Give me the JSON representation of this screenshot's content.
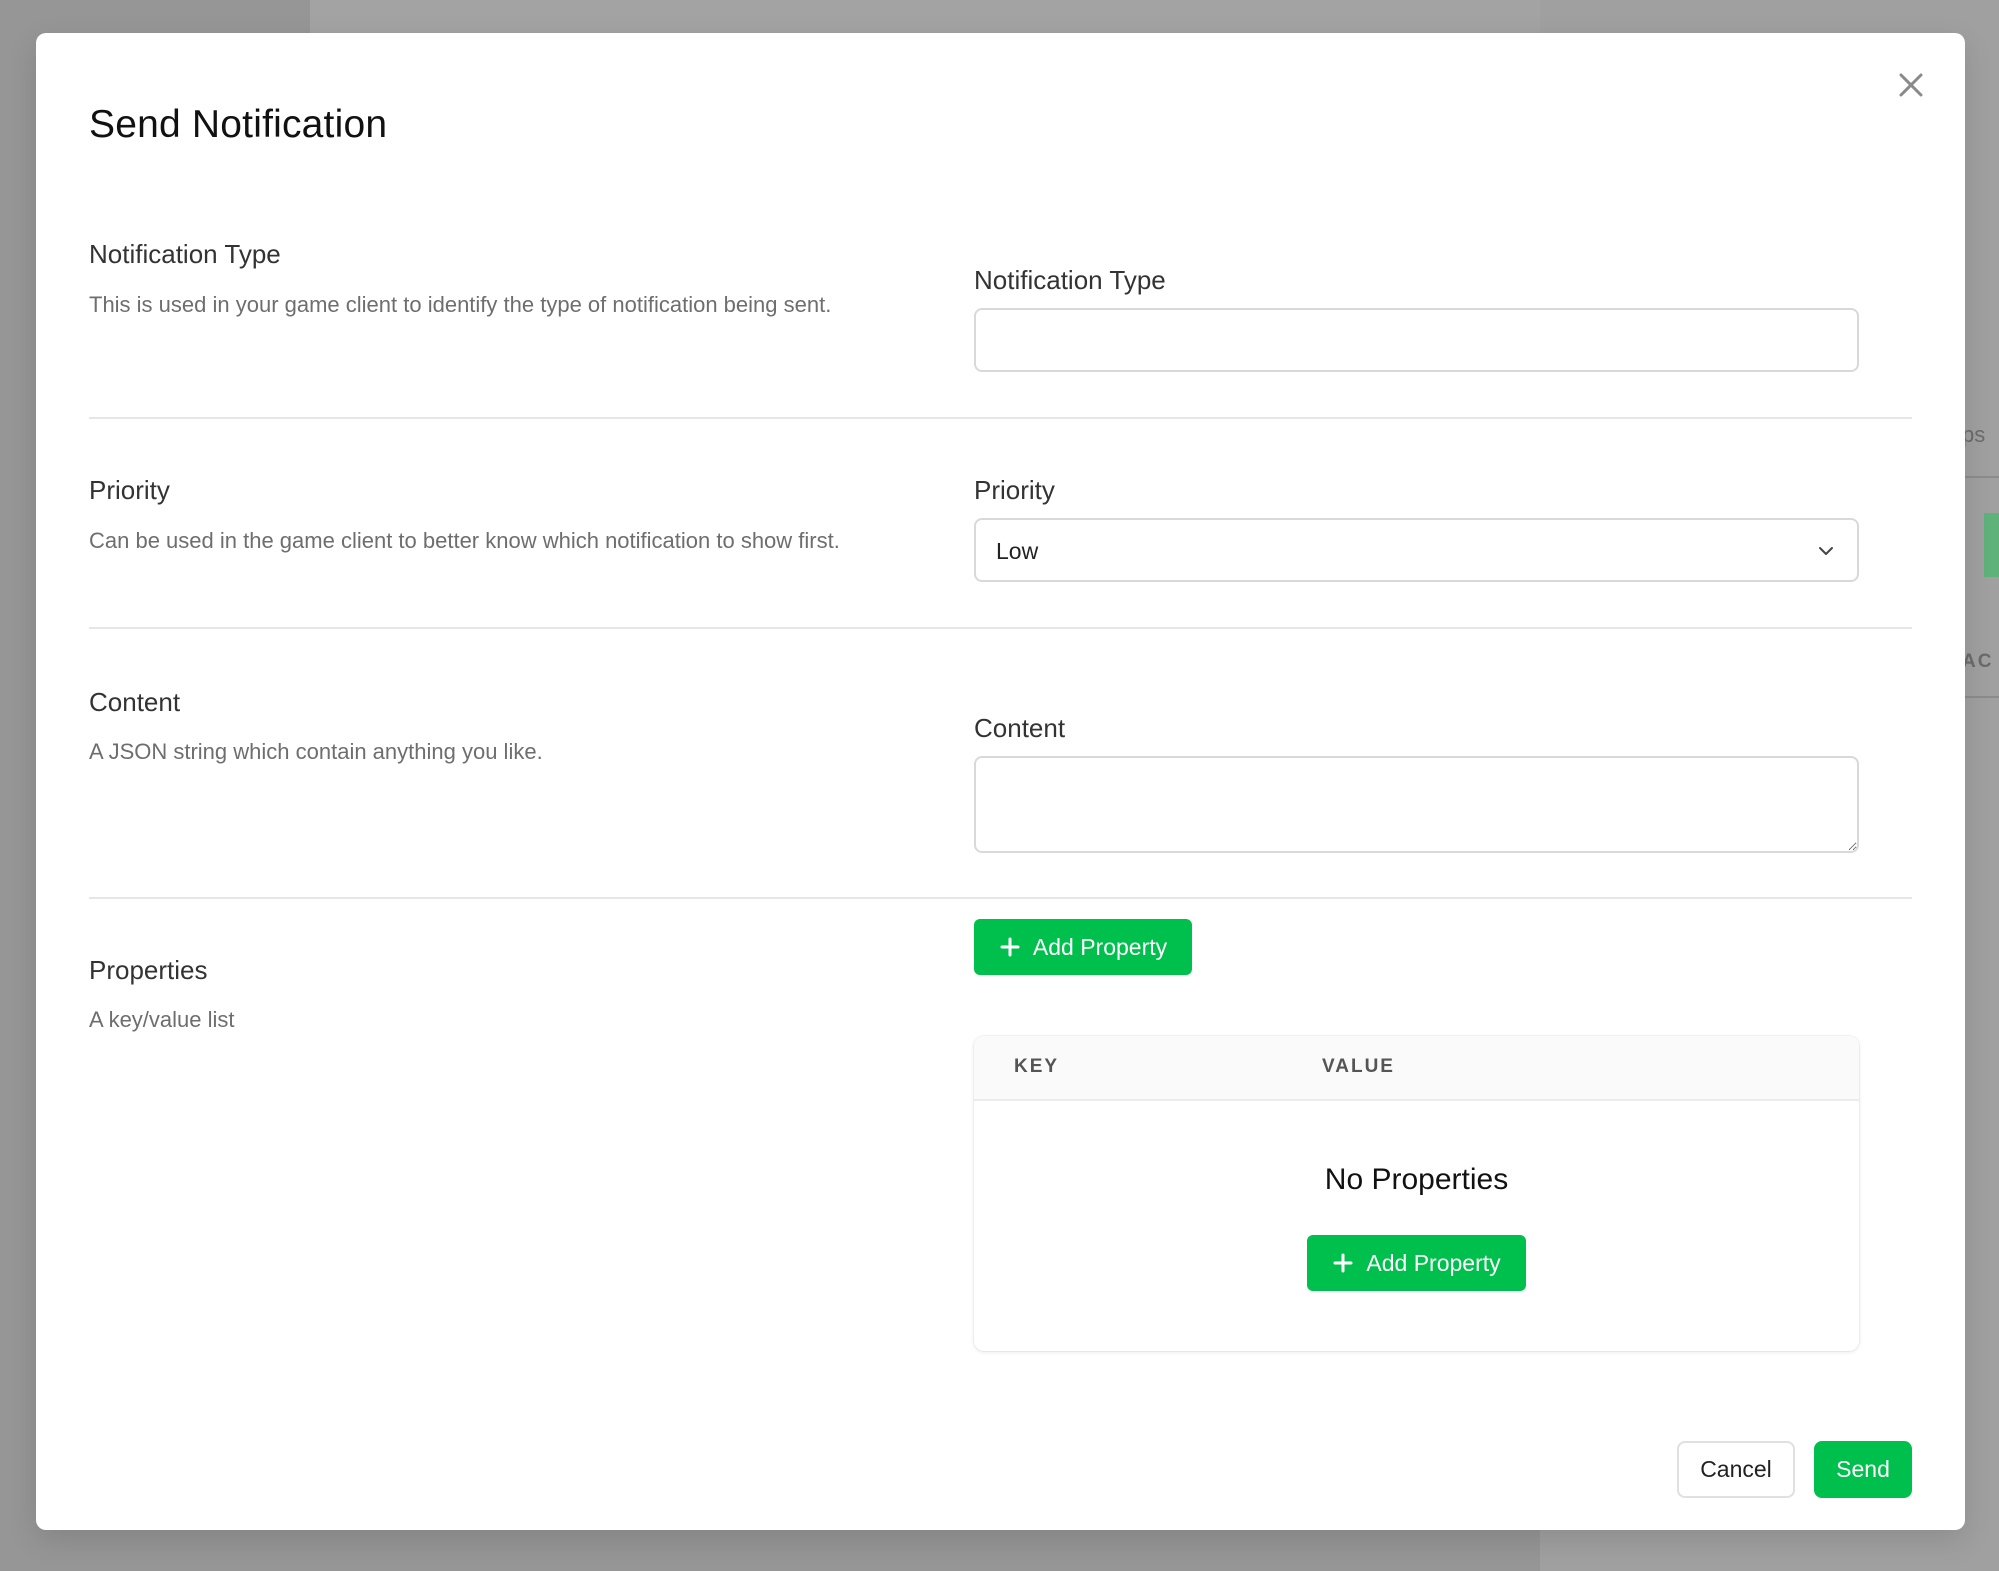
{
  "modal": {
    "title": "Send Notification",
    "close_icon": "close-icon"
  },
  "sections": {
    "notification_type": {
      "title": "Notification Type",
      "description": "This is used in your game client to identify the type of notification being sent.",
      "field_label": "Notification Type",
      "value": "",
      "placeholder": ""
    },
    "priority": {
      "title": "Priority",
      "description": "Can be used in the game client to better know which notification to show first.",
      "field_label": "Priority",
      "selected": "Low",
      "chevron_icon": "chevron-down-icon"
    },
    "content": {
      "title": "Content",
      "description": "A JSON string which contain anything you like.",
      "field_label": "Content",
      "value": ""
    },
    "properties": {
      "title": "Properties",
      "description": "A key/value list",
      "add_button_label": "Add Property",
      "table": {
        "columns": [
          "KEY",
          "VALUE"
        ],
        "rows": [],
        "empty_title": "No Properties",
        "empty_button_label": "Add Property"
      }
    }
  },
  "footer": {
    "cancel_label": "Cancel",
    "send_label": "Send"
  },
  "background": {
    "fragment_1": "ps",
    "fragment_2": "AC"
  },
  "colors": {
    "accent": "#00c04d",
    "overlay": "#969696"
  }
}
